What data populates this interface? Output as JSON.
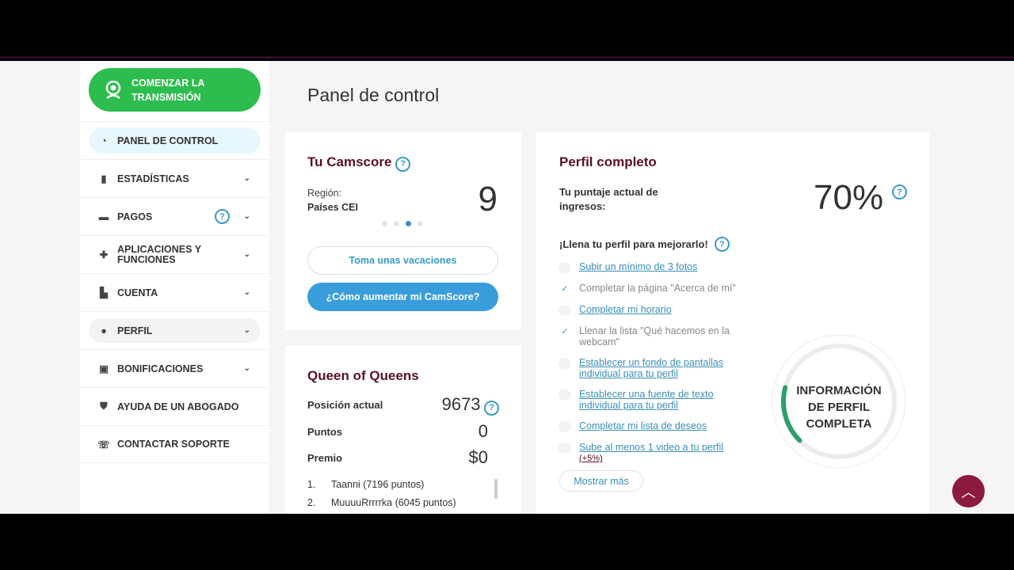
{
  "sidebar": {
    "stream_button": "COMENZAR LA TRANSMISIÓN",
    "items": [
      {
        "label": "PANEL DE CONTROL"
      },
      {
        "label": "ESTADÍSTICAS"
      },
      {
        "label": "PAGOS"
      },
      {
        "label": "APLICACIONES Y FUNCIONES"
      },
      {
        "label": "CUENTA"
      },
      {
        "label": "PERFIL"
      },
      {
        "label": "BONIFICACIONES"
      },
      {
        "label": "AYUDA DE UN ABOGADO"
      },
      {
        "label": "CONTACTAR SOPORTE"
      }
    ]
  },
  "page_title": "Panel de control",
  "camscore": {
    "title": "Tu Camscore",
    "region_label": "Región:",
    "region_value": "Países CEI",
    "score": "9",
    "carousel_active": 3,
    "vacation_button": "Toma unas vacaciones",
    "improve_button": "¿Cómo aumentar mi CamScore?"
  },
  "queen": {
    "title": "Queen of Queens",
    "position_label": "Posición actual",
    "position_value": "9673",
    "points_label": "Puntos",
    "points_value": "0",
    "prize_label": "Premio",
    "prize_value": "$0",
    "ranking": [
      {
        "rank": "1.",
        "name": "Taanni (7196 puntos)"
      },
      {
        "rank": "2.",
        "name": "MuuuuRrrrrka (6045 puntos)"
      }
    ]
  },
  "profile": {
    "title": "Perfil completo",
    "score_label": "Tu puntaje actual de ingresos:",
    "score_value": "70%",
    "fill_heading": "¡Llena tu perfil para mejorarlo!",
    "tasks": [
      {
        "text": "Subir un mínimo de 3 fotos",
        "done": false
      },
      {
        "text": "Completar la página \"Acerca de mí\"",
        "done": true
      },
      {
        "text": "Completar mi horario",
        "done": false
      },
      {
        "text": "Llenar la lista \"Qué hacemos en la webcam\"",
        "done": true
      },
      {
        "text": "Establecer un fondo de pantallas individual para tu perfil",
        "done": false
      },
      {
        "text": "Establecer una fuente de texto individual para tu perfil",
        "done": false
      },
      {
        "text": "Completar mi lista de deseos",
        "done": false
      },
      {
        "text": "Sube al menos 1 video a tu perfil",
        "done": false,
        "bonus": "(+5%)"
      }
    ],
    "show_more": "Mostrar más",
    "gauge_label": "INFORMACIÓN DE PERFIL COMPLETA",
    "gauge_color": "#2e9e6a"
  },
  "accent": "#3a9bc6",
  "brand": "#8b1a3c"
}
